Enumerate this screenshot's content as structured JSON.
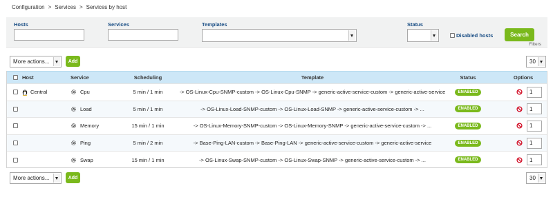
{
  "breadcrumb": [
    "Configuration",
    "Services",
    "Services by host"
  ],
  "breadcrumb_sep": ">",
  "filters": {
    "hosts_label": "Hosts",
    "hosts_value": "",
    "services_label": "Services",
    "services_value": "",
    "templates_label": "Templates",
    "templates_value": "",
    "status_label": "Status",
    "status_value": "",
    "disabled_hosts_label": "Disabled hosts",
    "search_label": "Search",
    "filters_link": "Filters"
  },
  "actions": {
    "more_actions_label": "More actions...",
    "add_label": "Add",
    "page_size": "30"
  },
  "table": {
    "headers": {
      "host": "Host",
      "service": "Service",
      "scheduling": "Scheduling",
      "template": "Template",
      "status": "Status",
      "options": "Options"
    },
    "rows": [
      {
        "host": "Central",
        "service": "Cpu",
        "scheduling": "5 min / 1 min",
        "template": "-> OS-Linux-Cpu-SNMP-custom -> OS-Linux-Cpu-SNMP -> generic-active-service-custom -> generic-active-service",
        "status": "ENABLED",
        "option": "1"
      },
      {
        "host": "",
        "service": "Load",
        "scheduling": "5 min / 1 min",
        "template": "-> OS-Linux-Load-SNMP-custom -> OS-Linux-Load-SNMP -> generic-active-service-custom -> ...",
        "status": "ENABLED",
        "option": "1"
      },
      {
        "host": "",
        "service": "Memory",
        "scheduling": "15 min / 1 min",
        "template": "-> OS-Linux-Memory-SNMP-custom -> OS-Linux-Memory-SNMP -> generic-active-service-custom -> ...",
        "status": "ENABLED",
        "option": "1"
      },
      {
        "host": "",
        "service": "Ping",
        "scheduling": "5 min / 2 min",
        "template": "-> Base-Ping-LAN-custom -> Base-Ping-LAN -> generic-active-service-custom -> generic-active-service",
        "status": "ENABLED",
        "option": "1"
      },
      {
        "host": "",
        "service": "Swap",
        "scheduling": "15 min / 1 min",
        "template": "-> OS-Linux-Swap-SNMP-custom -> OS-Linux-Swap-SNMP -> generic-active-service-custom -> ...",
        "status": "ENABLED",
        "option": "1"
      }
    ]
  },
  "icons": {
    "host": "linux-penguin-icon",
    "service": "gear-icon",
    "option": "disable-ban-icon"
  },
  "colors": {
    "accent_green": "#7ab91c",
    "header_blue": "#cde7f7",
    "label_blue": "#1a4e85",
    "ban_red": "#d0021b"
  }
}
